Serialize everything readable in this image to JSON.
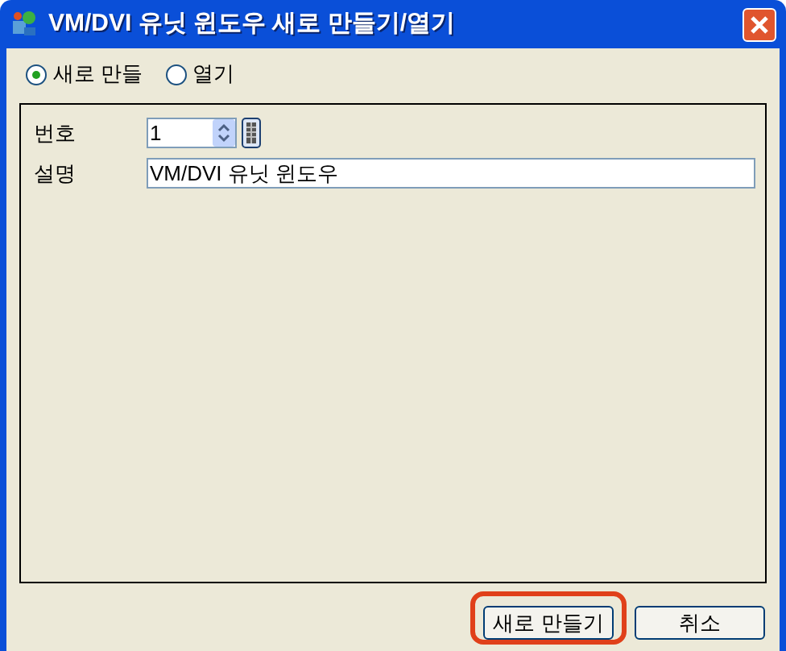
{
  "window": {
    "title": "VM/DVI 유닛 윈도우 새로 만들기/열기"
  },
  "modes": [
    {
      "label": "새로 만들",
      "selected": true
    },
    {
      "label": "열기",
      "selected": false
    }
  ],
  "fields": [
    {
      "kind": "spinner",
      "label": "번호",
      "value": "1"
    },
    {
      "kind": "text",
      "label": "설명",
      "value": "VM/DVI 유닛 윈도우"
    }
  ],
  "buttons": [
    {
      "label": "새로 만들기",
      "highlighted": true
    },
    {
      "label": "취소",
      "highlighted": false
    }
  ]
}
